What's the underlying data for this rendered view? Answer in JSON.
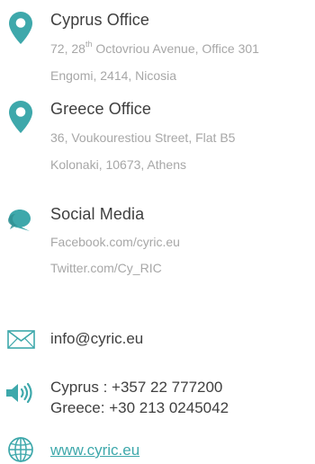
{
  "colors": {
    "accent": "#3ea8ab",
    "heading_text": "#3f3f3f",
    "muted_text": "#a7a7a7"
  },
  "cyprus_office": {
    "icon": "map-pin-icon",
    "title": "Cyprus Office",
    "address_number_prefix": "72, 28",
    "address_superscript": "th",
    "address_line1_rest": " Octovriou Avenue, Office 301",
    "address_line2": "Engomi, 2414, Nicosia"
  },
  "greece_office": {
    "icon": "map-pin-icon",
    "title": "Greece Office",
    "address_line1": "36, Voukourestiou Street, Flat B5",
    "address_line2": "Kolonaki, 10673, Athens"
  },
  "social_media": {
    "icon": "chat-bubbles-icon",
    "title": "Social Media",
    "facebook": "Facebook.com/cyric.eu",
    "twitter": "Twitter.com/Cy_RIC"
  },
  "email": {
    "icon": "envelope-icon",
    "address": "info@cyric.eu"
  },
  "phone": {
    "icon": "speaker-icon",
    "cyprus": "Cyprus : +357 22 777200",
    "greece": "Greece: +30 213 0245042"
  },
  "website": {
    "icon": "globe-icon",
    "url": "www.cyric.eu"
  }
}
